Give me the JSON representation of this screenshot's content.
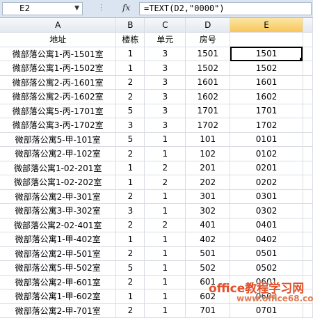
{
  "formula_bar": {
    "name_box": "E2",
    "fx_label": "fx",
    "formula": "=TEXT(D2,\"0000\")"
  },
  "columns": [
    "A",
    "B",
    "C",
    "D",
    "E"
  ],
  "active_column": "E",
  "header_row": [
    "地址",
    "楼栋",
    "单元",
    "房号",
    ""
  ],
  "rows": [
    [
      "微部落公寓1-丙-1501室",
      "1",
      "3",
      "1501",
      "1501"
    ],
    [
      "微部落公寓1-丙-1502室",
      "1",
      "3",
      "1502",
      "1502"
    ],
    [
      "微部落公寓2-丙-1601室",
      "2",
      "3",
      "1601",
      "1601"
    ],
    [
      "微部落公寓2-丙-1602室",
      "2",
      "3",
      "1602",
      "1602"
    ],
    [
      "微部落公寓5-丙-1701室",
      "5",
      "3",
      "1701",
      "1701"
    ],
    [
      "微部落公寓3-丙-1702室",
      "3",
      "3",
      "1702",
      "1702"
    ],
    [
      "微部落公寓5-甲-101室",
      "5",
      "1",
      "101",
      "0101"
    ],
    [
      "微部落公寓2-甲-102室",
      "2",
      "1",
      "102",
      "0102"
    ],
    [
      "微部落公寓1-02-201室",
      "1",
      "2",
      "201",
      "0201"
    ],
    [
      "微部落公寓1-02-202室",
      "1",
      "2",
      "202",
      "0202"
    ],
    [
      "微部落公寓2-甲-301室",
      "2",
      "1",
      "301",
      "0301"
    ],
    [
      "微部落公寓3-甲-302室",
      "3",
      "1",
      "302",
      "0302"
    ],
    [
      "微部落公寓2-02-401室",
      "2",
      "2",
      "401",
      "0401"
    ],
    [
      "微部落公寓1-甲-402室",
      "1",
      "1",
      "402",
      "0402"
    ],
    [
      "微部落公寓2-甲-501室",
      "2",
      "1",
      "501",
      "0501"
    ],
    [
      "微部落公寓5-甲-502室",
      "5",
      "1",
      "502",
      "0502"
    ],
    [
      "微部落公寓2-甲-601室",
      "2",
      "1",
      "601",
      "0601"
    ],
    [
      "微部落公寓1-甲-602室",
      "1",
      "1",
      "602",
      "0602"
    ],
    [
      "微部落公寓2-甲-701室",
      "2",
      "1",
      "701",
      "0701"
    ]
  ],
  "selected_cell": "E2",
  "watermark": {
    "title": "office教程学习网",
    "url": "www.office68.com"
  }
}
